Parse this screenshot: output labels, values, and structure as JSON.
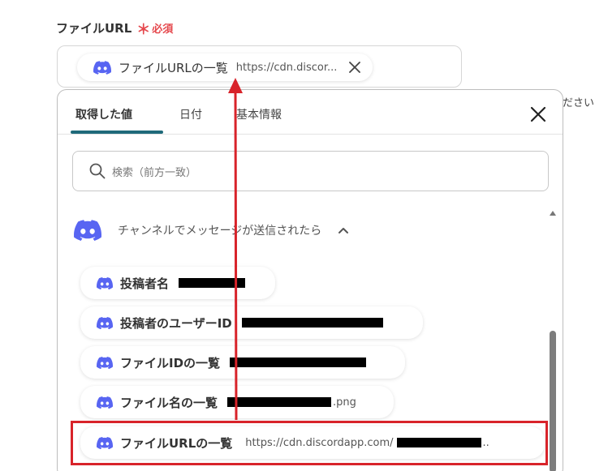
{
  "field": {
    "label": "ファイルURL",
    "required_star": "＊",
    "required_text": "必須",
    "chip_label": "ファイルURLの一覧",
    "chip_value": "https://cdn.discor..."
  },
  "side_text": "ださい",
  "panel": {
    "tabs": [
      "取得した値",
      "日付",
      "基本情報"
    ],
    "active_tab": "取得した値",
    "search_placeholder": "検索（前方一致）",
    "group_title": "チャンネルでメッセージが送信されたら",
    "items": [
      {
        "label": "投稿者名",
        "value": ""
      },
      {
        "label": "投稿者のユーザーID",
        "value": ""
      },
      {
        "label": "ファイルIDの一覧",
        "value": ""
      },
      {
        "label": "ファイル名の一覧",
        "value": ".png"
      },
      {
        "label": "ファイルURLの一覧",
        "value": "https://cdn.discordapp.com/",
        "suffix": ".."
      }
    ]
  },
  "colors": {
    "discord_blurple": "#5865F2",
    "required_red": "#e5484d",
    "tab_underline": "#1f6a7a",
    "annotation_red": "#d8232a"
  },
  "icons": {
    "discord": "discord-icon",
    "clear": "close-icon",
    "search": "search-icon",
    "collapse": "chevron-up-icon"
  }
}
